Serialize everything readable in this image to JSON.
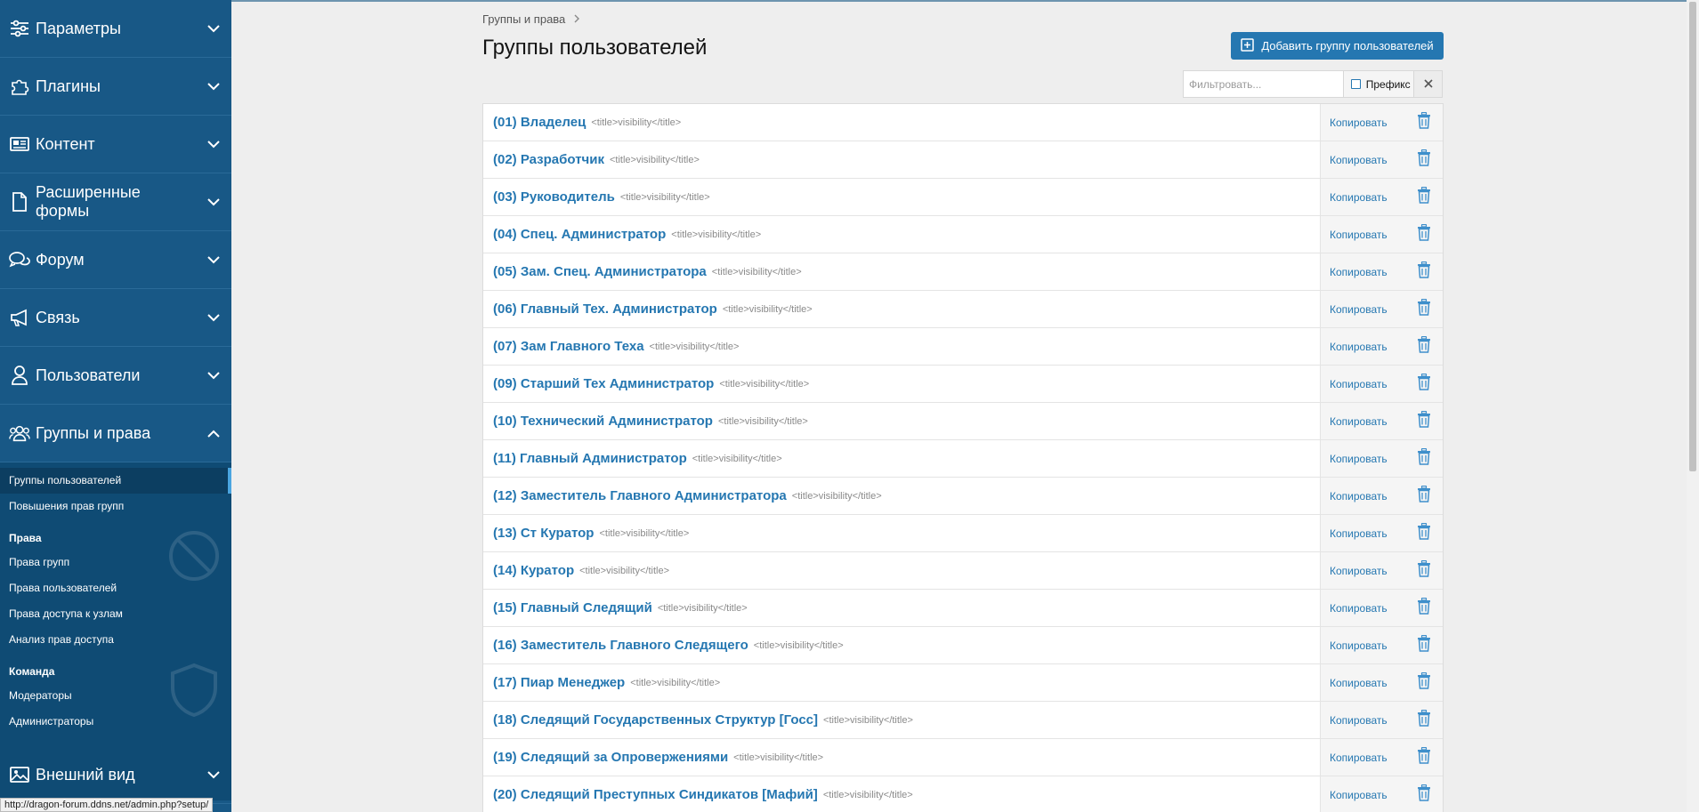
{
  "sidebar": {
    "items": [
      {
        "label": "Параметры",
        "icon": "sliders-icon"
      },
      {
        "label": "Плагины",
        "icon": "puzzle-icon"
      },
      {
        "label": "Контент",
        "icon": "newspaper-icon"
      },
      {
        "label": "Расширенные формы",
        "icon": "file-icon"
      },
      {
        "label": "Форум",
        "icon": "comments-icon"
      },
      {
        "label": "Связь",
        "icon": "megaphone-icon"
      },
      {
        "label": "Пользователи",
        "icon": "user-icon"
      },
      {
        "label": "Группы и права",
        "icon": "users-icon"
      }
    ],
    "sub": {
      "links1": [
        "Группы пользователей",
        "Повышения прав групп"
      ],
      "head_rights": "Права",
      "links2": [
        "Права групп",
        "Права пользователей",
        "Права доступа к узлам",
        "Анализ прав доступа"
      ],
      "head_team": "Команда",
      "links3": [
        "Модераторы",
        "Администраторы"
      ]
    },
    "bottom": {
      "label": "Внешний вид",
      "icon": "image-icon"
    }
  },
  "status_url": "http://dragon-forum.ddns.net/admin.php?setup/",
  "breadcrumb": {
    "item": "Группы и права"
  },
  "page": {
    "title": "Группы пользователей"
  },
  "actions": {
    "add_label": "Добавить группу пользователей"
  },
  "filter": {
    "placeholder": "Фильтровать...",
    "prefix_label": "Префикс"
  },
  "row_actions": {
    "copy_label": "Копировать"
  },
  "groups": [
    {
      "name": "(01) Владелец",
      "hint": "<title>visibility</title>"
    },
    {
      "name": "(02) Разработчик",
      "hint": "<title>visibility</title>"
    },
    {
      "name": "(03) Руководитель",
      "hint": "<title>visibility</title>"
    },
    {
      "name": "(04) Спец. Администратор",
      "hint": "<title>visibility</title>"
    },
    {
      "name": "(05) Зам. Спец. Администратора",
      "hint": "<title>visibility</title>"
    },
    {
      "name": "(06) Главный Тех. Администратор",
      "hint": "<title>visibility</title>"
    },
    {
      "name": "(07) Зам Главного Теха",
      "hint": "<title>visibility</title>"
    },
    {
      "name": "(09) Старший Тех Администратор",
      "hint": "<title>visibility</title>"
    },
    {
      "name": "(10) Технический Администратор",
      "hint": "<title>visibility</title>"
    },
    {
      "name": "(11) Главный Администратор",
      "hint": "<title>visibility</title>"
    },
    {
      "name": "(12) Заместитель Главного Администратора",
      "hint": "<title>visibility</title>"
    },
    {
      "name": "(13) Ст Куратор",
      "hint": "<title>visibility</title>"
    },
    {
      "name": "(14) Куратор",
      "hint": "<title>visibility</title>"
    },
    {
      "name": "(15) Главный Следящий",
      "hint": "<title>visibility</title>"
    },
    {
      "name": "(16) Заместитель Главного Следящего",
      "hint": "<title>visibility</title>"
    },
    {
      "name": "(17) Пиар Менеджер",
      "hint": "<title>visibility</title>"
    },
    {
      "name": "(18) Следящий Государственных Структур [Госс]",
      "hint": "<title>visibility</title>"
    },
    {
      "name": "(19) Следящий за Опровержениями",
      "hint": "<title>visibility</title>"
    },
    {
      "name": "(20) Следящий Преступных Синдикатов [Мафий]",
      "hint": "<title>visibility</title>"
    }
  ],
  "colors": {
    "sidebar": "#185886",
    "accent": "#2577b1",
    "background": "#eeeeee"
  }
}
